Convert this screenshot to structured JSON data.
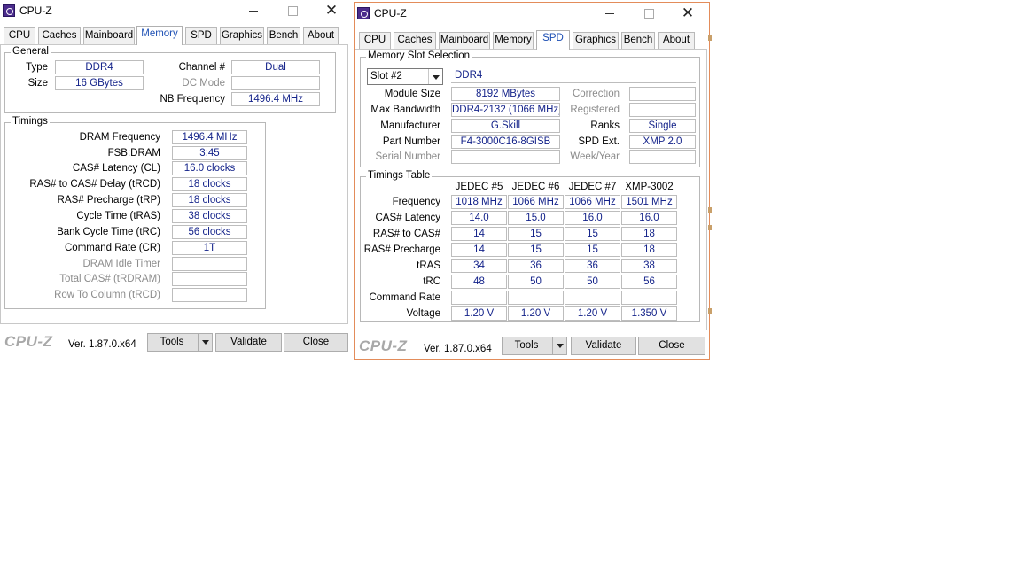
{
  "app": {
    "title": "CPU-Z",
    "brand": "CPU-Z",
    "version": "Ver. 1.87.0.x64",
    "close_glyph": "✕",
    "icon": "cpuz-app-icon",
    "accent": "#1e50b4",
    "value_color": "#14238a"
  },
  "tabs": [
    "CPU",
    "Caches",
    "Mainboard",
    "Memory",
    "SPD",
    "Graphics",
    "Bench",
    "About"
  ],
  "footer": {
    "tools": "Tools",
    "validate": "Validate",
    "close": "Close"
  },
  "memory_window": {
    "active_tab": "Memory",
    "general": {
      "legend": "General",
      "type_label": "Type",
      "type": "DDR4",
      "size_label": "Size",
      "size": "16 GBytes",
      "channel_label": "Channel #",
      "channel": "Dual",
      "dc_mode_label": "DC Mode",
      "dc_mode": "",
      "nb_freq_label": "NB Frequency",
      "nb_freq": "1496.4 MHz"
    },
    "timings": {
      "legend": "Timings",
      "rows": [
        {
          "label": "DRAM Frequency",
          "value": "1496.4 MHz",
          "enabled": true
        },
        {
          "label": "FSB:DRAM",
          "value": "3:45",
          "enabled": true
        },
        {
          "label": "CAS# Latency (CL)",
          "value": "16.0 clocks",
          "enabled": true
        },
        {
          "label": "RAS# to CAS# Delay (tRCD)",
          "value": "18 clocks",
          "enabled": true
        },
        {
          "label": "RAS# Precharge (tRP)",
          "value": "18 clocks",
          "enabled": true
        },
        {
          "label": "Cycle Time (tRAS)",
          "value": "38 clocks",
          "enabled": true
        },
        {
          "label": "Bank Cycle Time (tRC)",
          "value": "56 clocks",
          "enabled": true
        },
        {
          "label": "Command Rate (CR)",
          "value": "1T",
          "enabled": true
        },
        {
          "label": "DRAM Idle Timer",
          "value": "",
          "enabled": false
        },
        {
          "label": "Total CAS# (tRDRAM)",
          "value": "",
          "enabled": false
        },
        {
          "label": "Row To Column (tRCD)",
          "value": "",
          "enabled": false
        }
      ]
    }
  },
  "spd_window": {
    "active_tab": "SPD",
    "slot_section": {
      "legend": "Memory Slot Selection",
      "slot": "Slot #2",
      "type": "DDR4",
      "module_size_label": "Module Size",
      "module_size": "8192 MBytes",
      "max_bw_label": "Max Bandwidth",
      "max_bw": "DDR4-2132 (1066 MHz)",
      "manufacturer_label": "Manufacturer",
      "manufacturer": "G.Skill",
      "part_label": "Part Number",
      "part": "F4-3000C16-8GISB",
      "serial_label": "Serial Number",
      "serial": "",
      "correction_label": "Correction",
      "correction": "",
      "registered_label": "Registered",
      "registered": "",
      "ranks_label": "Ranks",
      "ranks": "Single",
      "spd_ext_label": "SPD Ext.",
      "spd_ext": "XMP 2.0",
      "week_year_label": "Week/Year",
      "week_year": ""
    },
    "timings_table": {
      "legend": "Timings Table",
      "columns": [
        "JEDEC #5",
        "JEDEC #6",
        "JEDEC #7",
        "XMP-3002"
      ],
      "rows": [
        {
          "label": "Frequency",
          "values": [
            "1018 MHz",
            "1066 MHz",
            "1066 MHz",
            "1501 MHz"
          ]
        },
        {
          "label": "CAS# Latency",
          "values": [
            "14.0",
            "15.0",
            "16.0",
            "16.0"
          ]
        },
        {
          "label": "RAS# to CAS#",
          "values": [
            "14",
            "15",
            "15",
            "18"
          ]
        },
        {
          "label": "RAS# Precharge",
          "values": [
            "14",
            "15",
            "15",
            "18"
          ]
        },
        {
          "label": "tRAS",
          "values": [
            "34",
            "36",
            "36",
            "38"
          ]
        },
        {
          "label": "tRC",
          "values": [
            "48",
            "50",
            "50",
            "56"
          ]
        },
        {
          "label": "Command Rate",
          "values": [
            "",
            "",
            "",
            ""
          ]
        },
        {
          "label": "Voltage",
          "values": [
            "1.20 V",
            "1.20 V",
            "1.20 V",
            "1.350 V"
          ]
        }
      ]
    }
  }
}
